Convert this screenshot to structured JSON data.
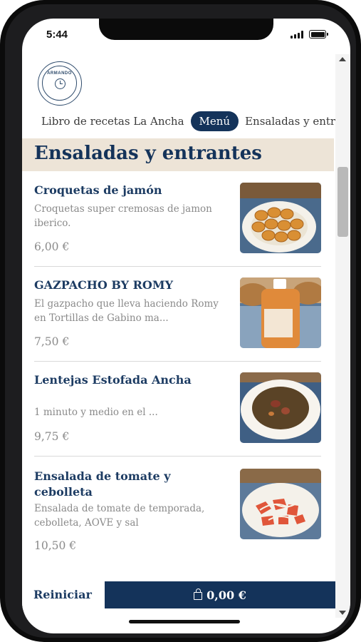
{
  "status_bar": {
    "time": "5:44"
  },
  "logo": {
    "text": "ARMANDO"
  },
  "nav": {
    "tabs": [
      {
        "label": "Libro de recetas La Ancha"
      },
      {
        "label": "Menú"
      },
      {
        "label": "Ensaladas y entrantes"
      }
    ],
    "active_index": 1
  },
  "category": {
    "title": "Ensaladas y entrantes"
  },
  "products": [
    {
      "name": "Croquetas de jamón",
      "description": "Croquetas super cremosas de jamon iberico.",
      "price": "6,00 €",
      "image": "croquetas-photo"
    },
    {
      "name": "GAZPACHO BY ROMY",
      "description": "El gazpacho que lleva haciendo Romy en Tortillas de Gabino ma...",
      "price": "7,50 €",
      "image": "gazpacho-bottle-photo"
    },
    {
      "name": "Lentejas Estofada Ancha",
      "description": "1 minuto y medio en el ...",
      "price": "9,75 €",
      "image": "lentejas-photo"
    },
    {
      "name": "Ensalada de tomate y cebolleta",
      "description": "Ensalada de tomate de temporada, cebolleta, AOVE y sal",
      "price": "10,50 €",
      "image": "ensalada-photo"
    }
  ],
  "footer": {
    "reset_label": "Reiniciar",
    "cart_total": "0,00 €",
    "cart_icon": "shopping-bag-icon"
  },
  "colors": {
    "primary": "#14335a",
    "header_bg": "#ede4d7",
    "muted_text": "#8a8a8a"
  }
}
